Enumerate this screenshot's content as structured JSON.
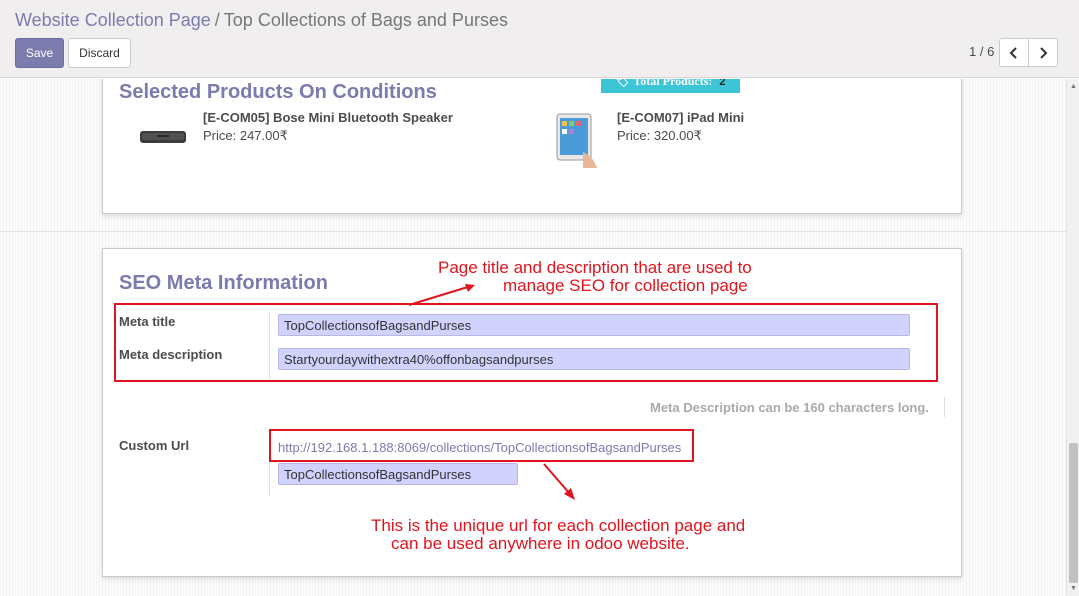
{
  "breadcrumb": {
    "parent": "Website Collection Page",
    "separator": "/",
    "current": "Top Collections of Bags and Purses"
  },
  "buttons": {
    "save": "Save",
    "discard": "Discard"
  },
  "pager": {
    "value": "1 / 6"
  },
  "products_section": {
    "title": "Selected Products On Conditions",
    "total_label": "Total Products:",
    "total_count": "2",
    "products": [
      {
        "name": "[E-COM05] Bose Mini Bluetooth Speaker",
        "price": "Price: 247.00₹"
      },
      {
        "name": "[E-COM07] iPad Mini",
        "price": "Price: 320.00₹"
      }
    ]
  },
  "seo_section": {
    "title": "SEO Meta Information",
    "meta_title_label": "Meta title",
    "meta_title_value": "TopCollectionsofBagsandPurses",
    "meta_description_label": "Meta description",
    "meta_description_value": "Startyourdaywithextra40%offonbagsandpurses",
    "meta_help": "Meta Description can be 160 characters long.",
    "custom_url_label": "Custom Url",
    "custom_url_link": "http://192.168.1.188:8069/collections/TopCollectionsofBagsandPurses",
    "custom_url_value": "TopCollectionsofBagsandPurses"
  },
  "annotations": {
    "seo_line1": "Page title and description that are used to",
    "seo_line2": "manage SEO for collection page",
    "url_line1": "This is the unique url for each collection page and",
    "url_line2": "can be used anywhere in odoo website."
  },
  "colors": {
    "accent": "#7c7bad",
    "badge": "#3cc5d6",
    "input_bg": "#d2d2ff",
    "annotation": "#e0141e"
  }
}
